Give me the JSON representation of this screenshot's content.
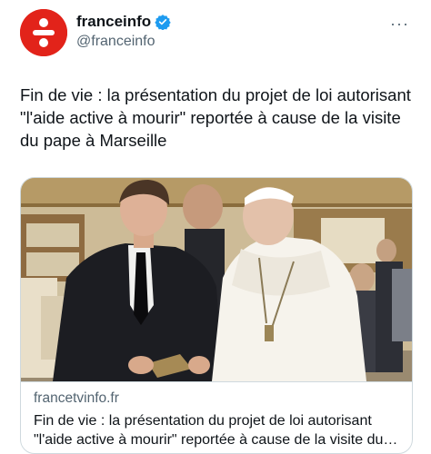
{
  "account": {
    "display_name": "franceinfo",
    "handle": "@franceinfo",
    "verified_icon": "verified-badge-icon",
    "brand_color": "#e2231a",
    "verified_color": "#1d9bf0"
  },
  "menu": {
    "more_label": "···"
  },
  "tweet": {
    "text": "Fin de vie : la présentation du projet de loi autorisant \"l'aide active à mourir\" reportée à cause de la visite du pape à Marseille"
  },
  "link_card": {
    "domain": "francetvinfo.fr",
    "title": "Fin de vie : la présentation du projet de loi autorisant \"l'aide active à mourir\" reportée à cause de la visite du pape à Marseille"
  }
}
